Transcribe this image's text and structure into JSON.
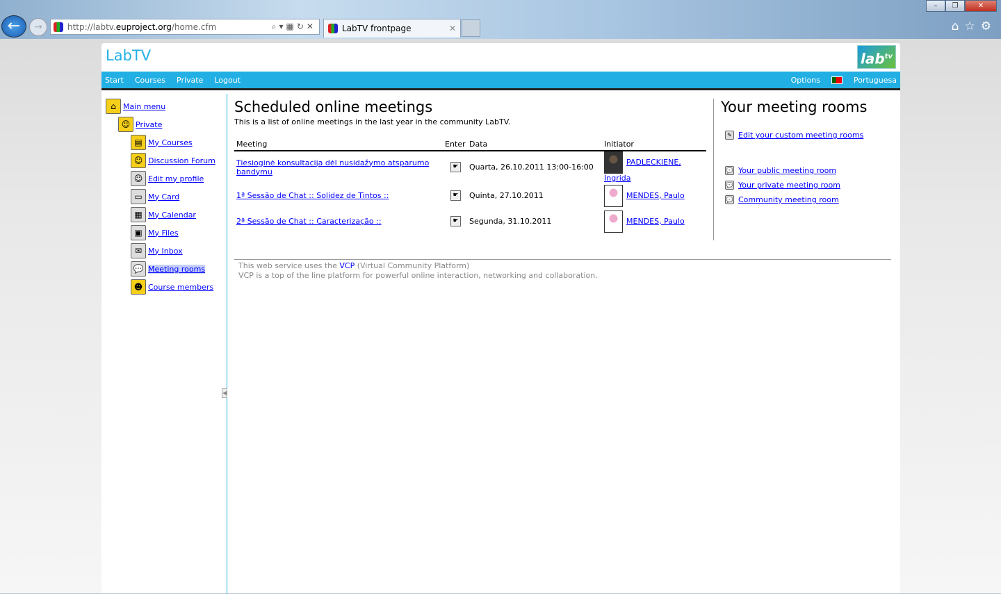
{
  "browser": {
    "url_prefix": "http://labtv.",
    "url_domain": "euproject.org",
    "url_suffix": "/home.cfm",
    "tab_title": "LabTV frontpage"
  },
  "header": {
    "brand": "LabTV",
    "logo": "lab tv"
  },
  "nav": {
    "items": [
      "Start",
      "Courses",
      "Private",
      "Logout"
    ],
    "options": "Options",
    "language": "Portuguesa"
  },
  "sidebar": {
    "items": [
      {
        "label": "Main menu",
        "icon": "home-folder-icon",
        "level": 0
      },
      {
        "label": "Private",
        "icon": "private-folder-icon",
        "level": 1
      },
      {
        "label": "My Courses",
        "icon": "courses-icon",
        "level": 2
      },
      {
        "label": "Discussion Forum",
        "icon": "forum-icon",
        "level": 2
      },
      {
        "label": "Edit my profile",
        "icon": "profile-icon",
        "level": 2
      },
      {
        "label": "My Card",
        "icon": "card-icon",
        "level": 2
      },
      {
        "label": "My Calendar",
        "icon": "calendar-icon",
        "level": 2
      },
      {
        "label": "My Files",
        "icon": "floppy-icon",
        "level": 2
      },
      {
        "label": "My Inbox",
        "icon": "envelope-icon",
        "level": 2
      },
      {
        "label": "Meeting rooms",
        "icon": "meeting-icon",
        "level": 2,
        "selected": true
      },
      {
        "label": "Course members",
        "icon": "members-icon",
        "level": 2
      }
    ]
  },
  "main": {
    "title": "Scheduled online meetings",
    "subtitle": "This is a list of online meetings in the last year in the community LabTV.",
    "columns": [
      "Meeting",
      "Enter",
      "Data",
      "Initiator"
    ],
    "rows": [
      {
        "meeting": "Tiesioginė konsultacija dėl nusidažymo atsparumo bandymu",
        "date": "Quarta, 26.10.2011 13:00-16:00",
        "initiator": "PADLECKIENE, Ingrida"
      },
      {
        "meeting": "1ª Sessão de Chat :: Solidez de Tintos ::",
        "date": "Quinta, 27.10.2011",
        "initiator": "MENDES, Paulo"
      },
      {
        "meeting": "2ª Sessão de Chat :: Caracterização ::",
        "date": "Segunda, 31.10.2011",
        "initiator": "MENDES, Paulo"
      }
    ]
  },
  "rooms": {
    "title": "Your meeting rooms",
    "edit": "Edit your custom meeting rooms",
    "public": "Your public meeting room",
    "private": "Your private meeting room",
    "community": "Community meeting room"
  },
  "footer": {
    "l1a": "This web service uses the ",
    "l1b": "VCP",
    "l1c": " (Virtual Community Platform)",
    "l2": "VCP is a top of the line platform for powerful online interaction, networking and collaboration."
  },
  "colors": {
    "accent": "#22b0e4",
    "link": "#0000ff"
  }
}
